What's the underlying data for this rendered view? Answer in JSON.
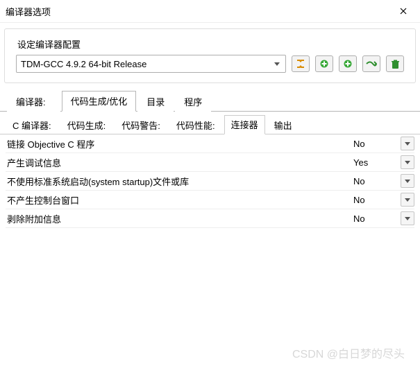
{
  "window": {
    "title": "编译器选项"
  },
  "config": {
    "label": "设定编译器配置",
    "selected": "TDM-GCC 4.9.2 64-bit Release",
    "icons": [
      "find-replace-icon",
      "add-copy-icon",
      "add-icon",
      "rename-icon",
      "delete-icon"
    ]
  },
  "tabs": {
    "items": [
      {
        "label": "编译器",
        "suffix": ":"
      },
      {
        "label": "代码生成/优化",
        "suffix": ""
      },
      {
        "label": "目录",
        "suffix": ""
      },
      {
        "label": "程序",
        "suffix": ""
      }
    ],
    "active": 1
  },
  "subtabs": {
    "items": [
      {
        "label": "C 编译器",
        "suffix": ":"
      },
      {
        "label": "代码生成",
        "suffix": ":"
      },
      {
        "label": "代码警告",
        "suffix": ":"
      },
      {
        "label": "代码性能",
        "suffix": ":"
      },
      {
        "label": "连接器",
        "suffix": ""
      },
      {
        "label": "输出",
        "suffix": ""
      }
    ],
    "active": 4
  },
  "options": [
    {
      "label": "链接 Objective C 程序",
      "value": "No"
    },
    {
      "label": "产生调试信息",
      "value": "Yes"
    },
    {
      "label": "不使用标准系统启动(system startup)文件或库",
      "value": "No"
    },
    {
      "label": "不产生控制台窗口",
      "value": "No"
    },
    {
      "label": "剥除附加信息",
      "value": "No"
    }
  ],
  "watermark": "CSDN @白日梦的尽头"
}
